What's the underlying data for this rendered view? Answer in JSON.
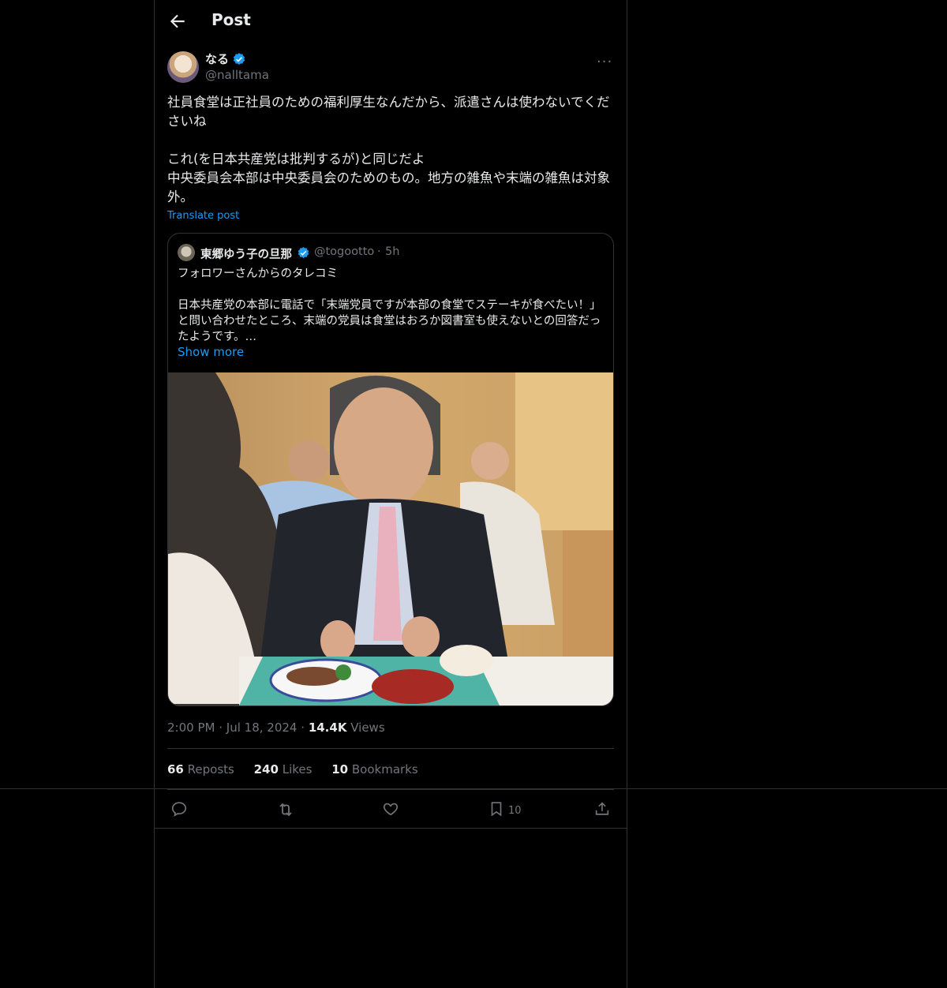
{
  "header": {
    "title": "Post"
  },
  "post": {
    "author_name": "なる",
    "author_handle": "@nalltama",
    "text": "社員食堂は正社員のための福利厚生なんだから、派遣さんは使わないでくださいね\n\nこれ(を日本共産党は批判するが)と同じだよ\n中央委員会本部は中央委員会のためのもの。地方の雑魚や末端の雑魚は対象外。",
    "translate_label": "Translate post",
    "time": "2:00 PM",
    "date": "Jul 18, 2024",
    "views_count": "14.4K",
    "views_label": "Views",
    "sep": "·"
  },
  "quote": {
    "author_name": "東郷ゆう子の旦那",
    "author_handle": "@togootto",
    "sep": "·",
    "age": "5h",
    "text": "フォロワーさんからのタレコミ\n\n日本共産党の本部に電話で「末端党員ですが本部の食堂でステーキが食べたい！」と問い合わせたところ、末端の党員は食堂はおろか図書室も使えないとの回答だったようです。…",
    "show_more": "Show more"
  },
  "stats": {
    "reposts_count": "66",
    "reposts_label": "Reposts",
    "likes_count": "240",
    "likes_label": "Likes",
    "bookmarks_count": "10",
    "bookmarks_label": "Bookmarks"
  },
  "actions": {
    "bookmark_count": "10"
  },
  "colors": {
    "accent": "#1d9bf0",
    "border": "#2f3336",
    "muted": "#71767b",
    "text": "#e7e9ea"
  },
  "icons": [
    "back-arrow-icon",
    "verified-badge-icon",
    "more-icon",
    "reply-icon",
    "repost-icon",
    "like-icon",
    "bookmark-icon",
    "share-icon"
  ]
}
